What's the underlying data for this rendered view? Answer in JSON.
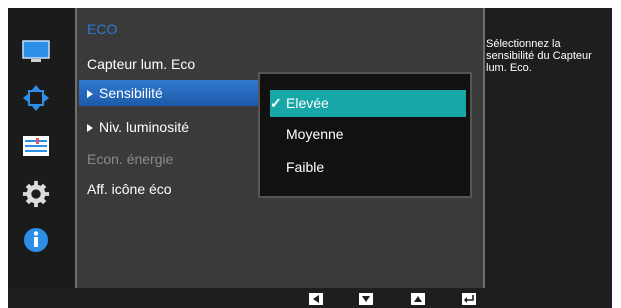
{
  "menu": {
    "title": "ECO",
    "items": [
      {
        "label": "Capteur lum. Eco",
        "has_arrow": false,
        "state": "normal"
      },
      {
        "label": "Sensibilité",
        "has_arrow": true,
        "state": "selected"
      },
      {
        "label": "Niv. luminosité",
        "has_arrow": true,
        "state": "normal"
      },
      {
        "label": "Econ. énergie",
        "has_arrow": false,
        "state": "disabled"
      },
      {
        "label": "Aff. icône éco",
        "has_arrow": false,
        "state": "normal"
      }
    ]
  },
  "submenu": {
    "options": [
      {
        "label": "Elevée",
        "selected": true
      },
      {
        "label": "Moyenne",
        "selected": false
      },
      {
        "label": "Faible",
        "selected": false
      }
    ]
  },
  "help": {
    "text": "Sélectionnez la sensibilité du Capteur lum. Eco."
  },
  "nav_keys": [
    {
      "icon": "left-arrow-icon"
    },
    {
      "icon": "down-arrow-icon"
    },
    {
      "icon": "up-arrow-icon"
    },
    {
      "icon": "enter-icon"
    }
  ],
  "colors": {
    "accent_blue": "#2a7bd6",
    "selected_option": "#18a7a7",
    "panel": "#3a3a3a",
    "background": "#1e1e1e"
  }
}
